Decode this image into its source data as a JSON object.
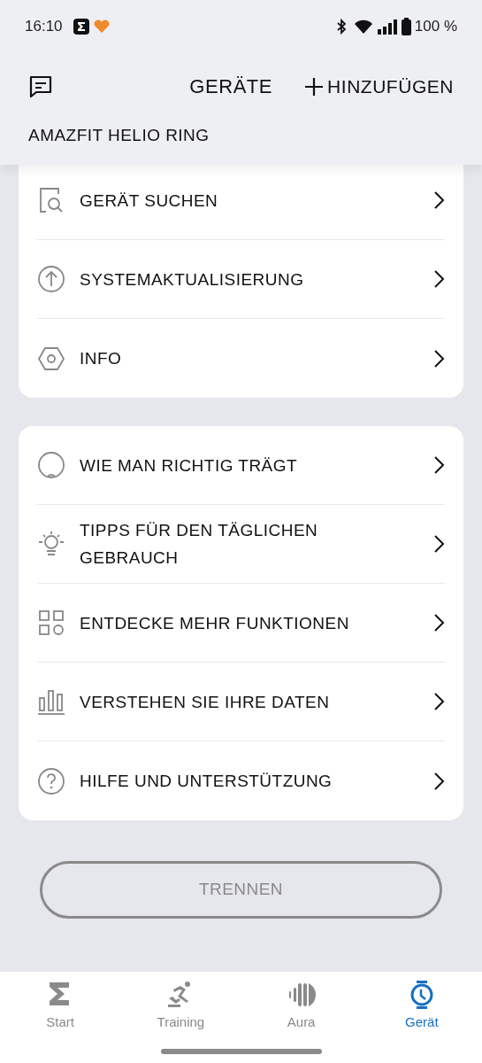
{
  "status_bar": {
    "time": "16:10",
    "battery": "100 %"
  },
  "header": {
    "title": "GERÄTE",
    "add_label": "HINZUFÜGEN",
    "device_name": "AMAZFIT HELIO RING"
  },
  "groups": [
    {
      "items": [
        {
          "label": "GERÄT SUCHEN"
        },
        {
          "label": "SYSTEMAKTUALISIERUNG"
        },
        {
          "label": "INFO"
        }
      ]
    },
    {
      "items": [
        {
          "label": "WIE MAN RICHTIG TRÄGT"
        },
        {
          "label": "TIPPS FÜR DEN TÄGLICHEN GEBRAUCH"
        },
        {
          "label": "ENTDECKE MEHR FUNKTIONEN"
        },
        {
          "label": "VERSTEHEN SIE IHRE DATEN"
        },
        {
          "label": "HILFE UND UNTERSTÜTZUNG"
        }
      ]
    }
  ],
  "disconnect_button": "TRENNEN",
  "bottom_nav": [
    {
      "label": "Start",
      "selected": false
    },
    {
      "label": "Training",
      "selected": false
    },
    {
      "label": "Aura",
      "selected": false
    },
    {
      "label": "Gerät",
      "selected": true
    }
  ]
}
